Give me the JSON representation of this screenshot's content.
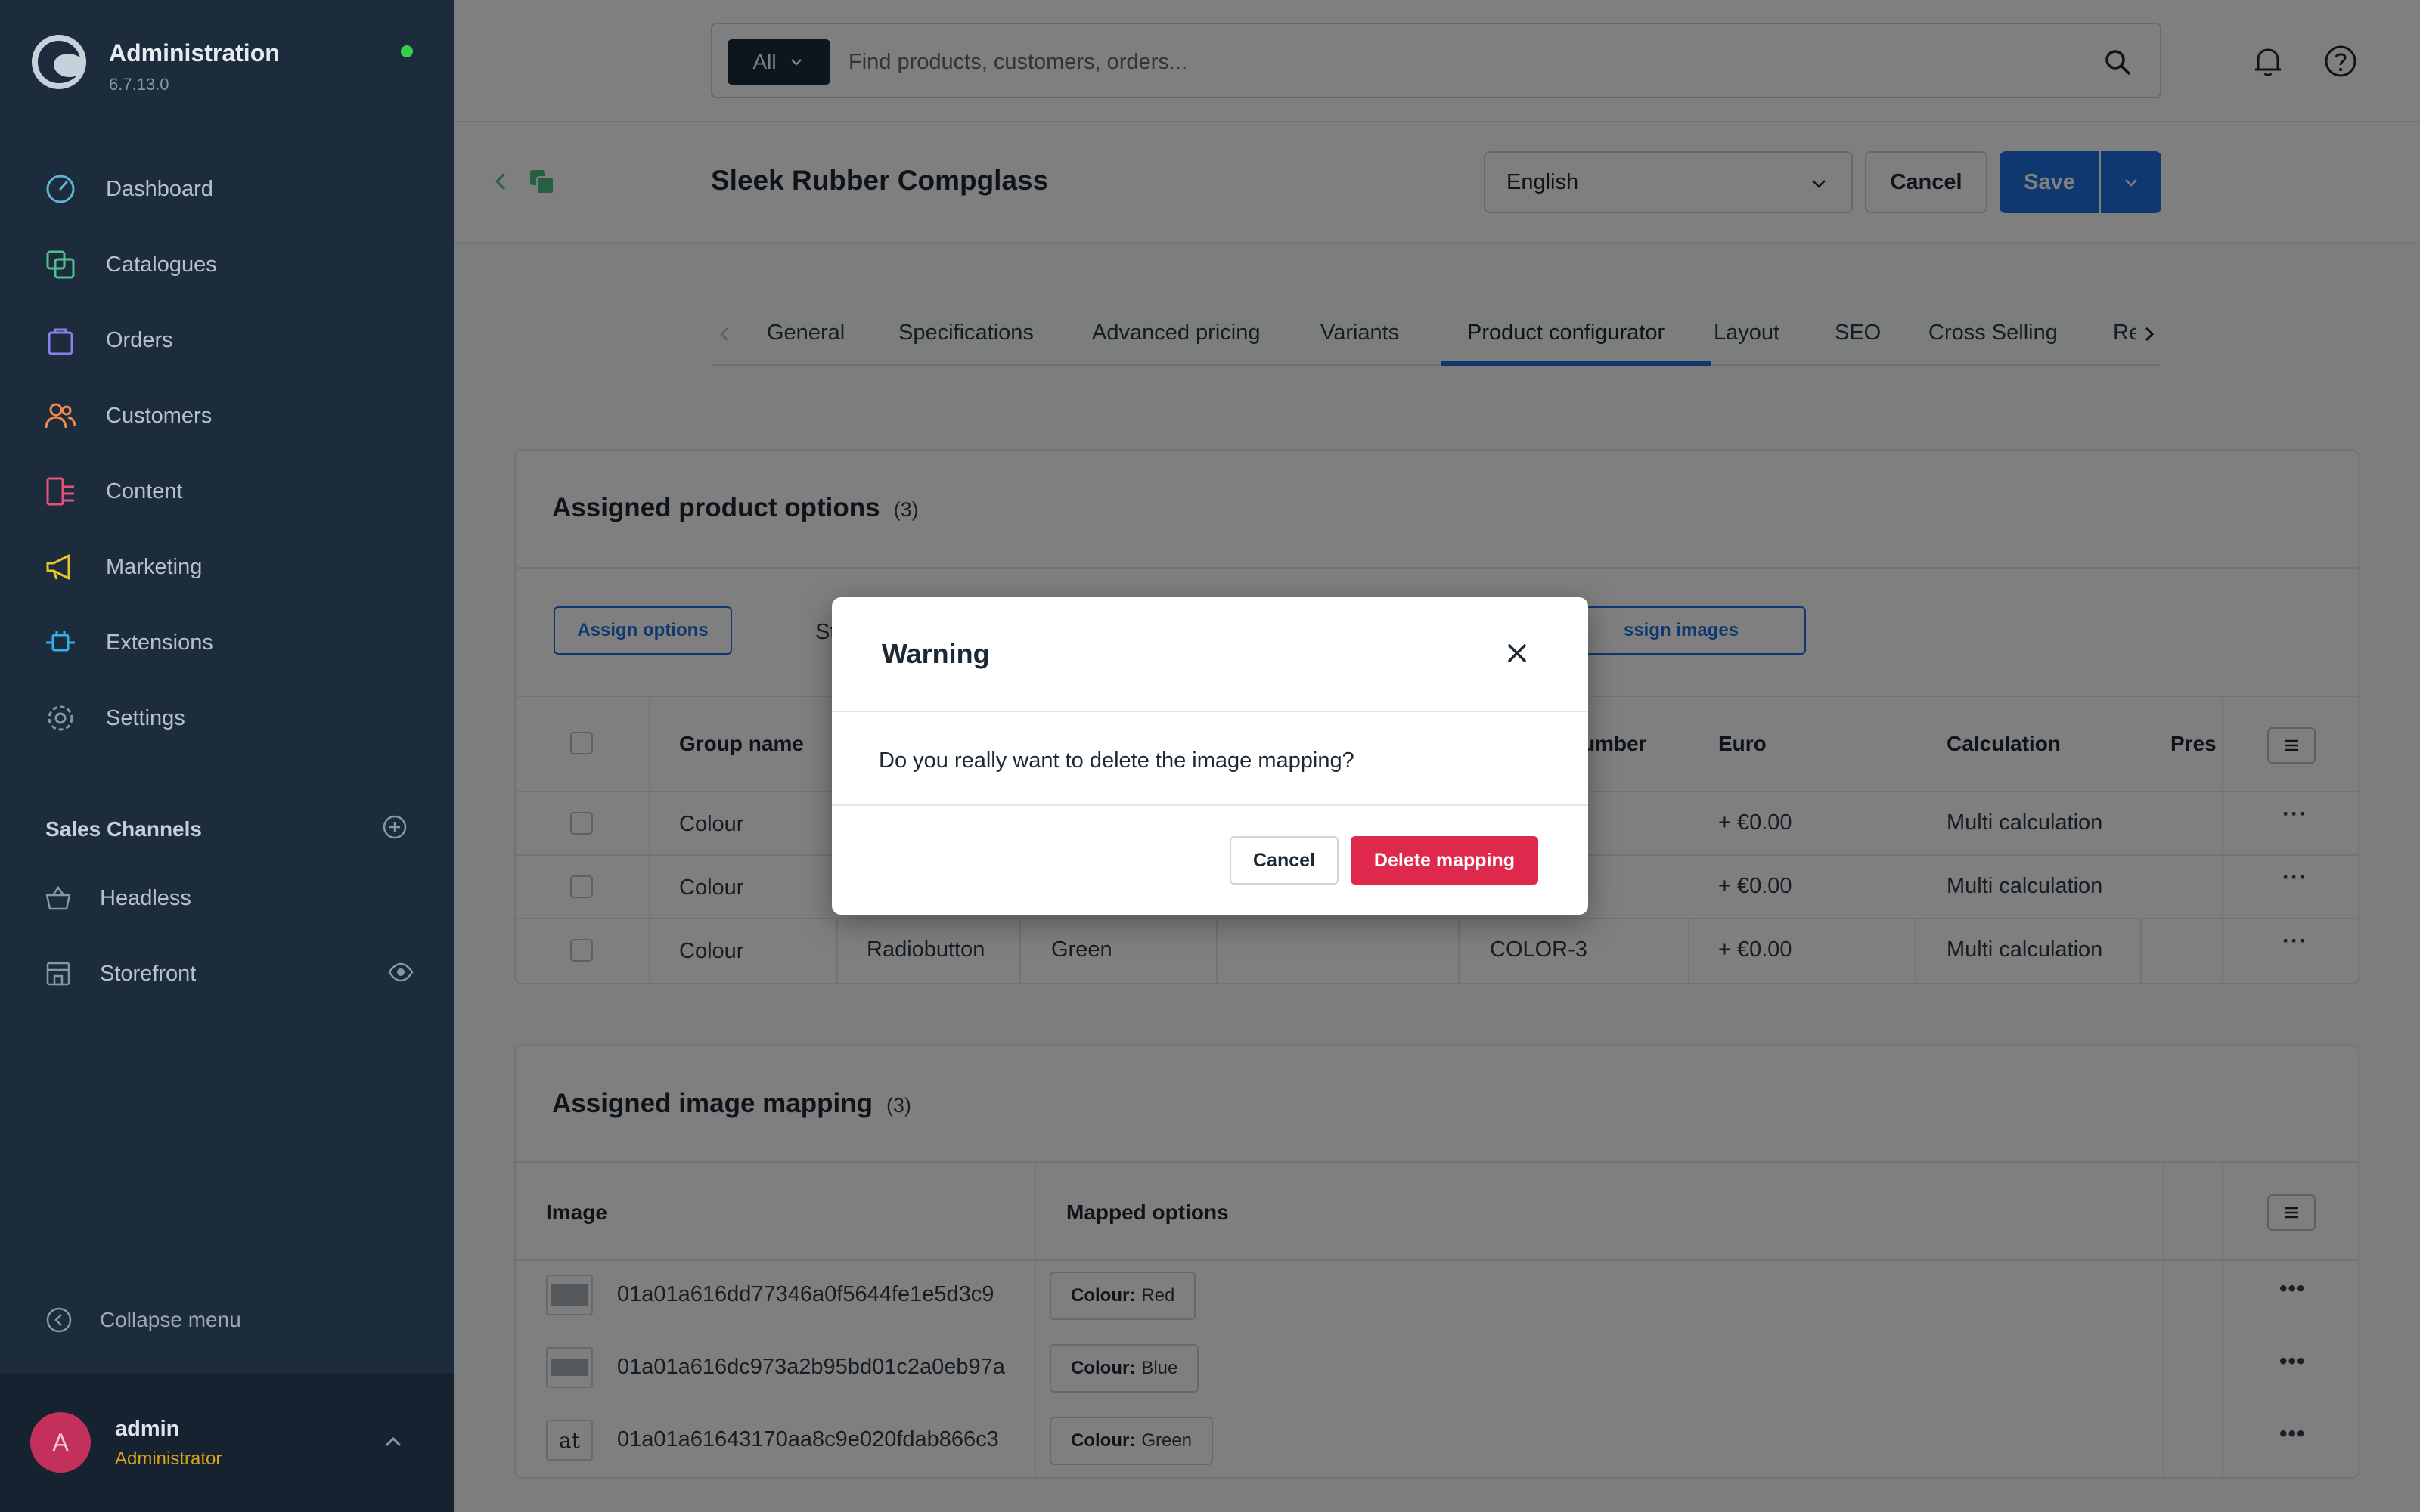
{
  "app": {
    "title": "Administration",
    "version": "6.7.13.0"
  },
  "sidebar": {
    "items": [
      {
        "label": "Dashboard",
        "icon": "gauge-icon",
        "color": "#5fb3d4"
      },
      {
        "label": "Catalogues",
        "icon": "stack-icon",
        "color": "#4fbf8b"
      },
      {
        "label": "Orders",
        "icon": "shopping-bag-icon",
        "color": "#8a7ff0"
      },
      {
        "label": "Customers",
        "icon": "users-icon",
        "color": "#f08a4b"
      },
      {
        "label": "Content",
        "icon": "content-icon",
        "color": "#e5527b"
      },
      {
        "label": "Marketing",
        "icon": "megaphone-icon",
        "color": "#e8c52e"
      },
      {
        "label": "Extensions",
        "icon": "plug-icon",
        "color": "#2fb3e6"
      },
      {
        "label": "Settings",
        "icon": "gear-icon",
        "color": "#8797a8"
      }
    ],
    "sales_channels": {
      "title": "Sales Channels",
      "items": [
        {
          "label": "Headless",
          "icon": "basket-icon"
        },
        {
          "label": "Storefront",
          "icon": "store-icon"
        }
      ]
    },
    "collapse_label": "Collapse menu",
    "user": {
      "initial": "A",
      "name": "admin",
      "role": "Administrator"
    }
  },
  "search": {
    "type_label": "All",
    "placeholder": "Find products, customers, orders..."
  },
  "smartbar": {
    "title": "Sleek Rubber Compglass",
    "language": "English",
    "cancel_label": "Cancel",
    "save_label": "Save"
  },
  "tabs": [
    {
      "label": "General"
    },
    {
      "label": "Specifications"
    },
    {
      "label": "Advanced pricing"
    },
    {
      "label": "Variants"
    },
    {
      "label": "Product configurator",
      "active": true
    },
    {
      "label": "Layout"
    },
    {
      "label": "SEO"
    },
    {
      "label": "Cross Selling"
    },
    {
      "label": "Re"
    }
  ],
  "options_card": {
    "title": "Assigned product options",
    "count": "(3)",
    "assign_options_label": "Assign options",
    "hidden_label_fragment": "St",
    "assign_images_label": "ssign images",
    "columns": {
      "group": "Group name",
      "number": "umber",
      "euro": "Euro",
      "calculation": "Calculation",
      "preset": "Prese"
    },
    "rows": [
      {
        "group": "Colour",
        "display": "",
        "option": "",
        "number": "",
        "euro": "+ €0.00",
        "calc": "Multi calculation"
      },
      {
        "group": "Colour",
        "display": "",
        "option": "",
        "number": "",
        "euro": "+ €0.00",
        "calc": "Multi calculation"
      },
      {
        "group": "Colour",
        "display": "Radiobutton",
        "option": "Green",
        "number": "COLOR-3",
        "euro": "+ €0.00",
        "calc": "Multi calculation"
      }
    ],
    "row_action": "···"
  },
  "mapping_card": {
    "title": "Assigned image mapping",
    "count": "(3)",
    "columns": {
      "image": "Image",
      "mapped": "Mapped options"
    },
    "rows": [
      {
        "thumb": "",
        "id": "01a01a616dd77346a0f5644fe1e5d3c9",
        "chip_key": "Colour:",
        "chip_value": "Red"
      },
      {
        "thumb": "",
        "id": "01a01a616dc973a2b95bd01c2a0eb97a",
        "chip_key": "Colour:",
        "chip_value": "Blue"
      },
      {
        "thumb": "at",
        "id": "01a01a61643170aa8c9e020fdab866c3",
        "chip_key": "Colour:",
        "chip_value": "Green"
      }
    ],
    "row_action": "•••"
  },
  "modal": {
    "title": "Warning",
    "body": "Do you really want to delete the image mapping?",
    "cancel_label": "Cancel",
    "confirm_label": "Delete mapping"
  },
  "colors": {
    "sidebar": "#1d2c3d",
    "primary": "#1e6fe0",
    "danger": "#de294c",
    "status_online": "#37d046"
  }
}
